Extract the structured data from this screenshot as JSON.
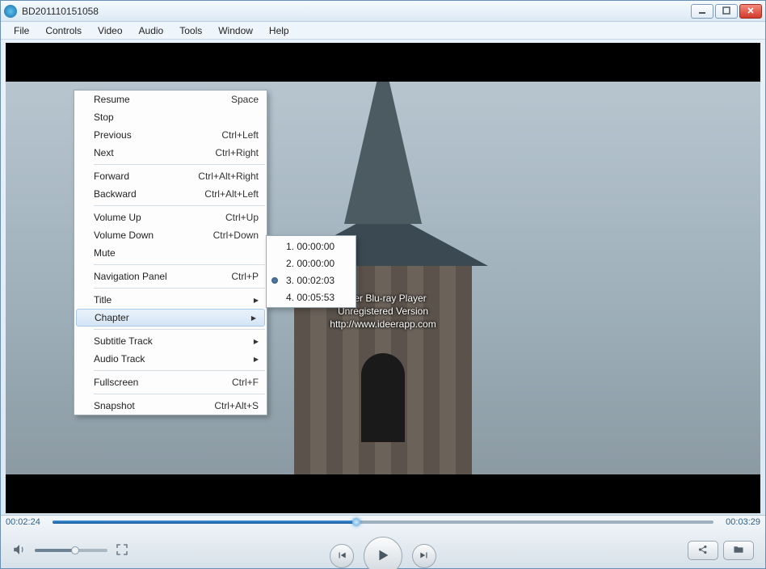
{
  "titlebar": {
    "title": "BD201110151058"
  },
  "menubar": [
    "File",
    "Controls",
    "Video",
    "Audio",
    "Tools",
    "Window",
    "Help"
  ],
  "watermark": {
    "line1": "iDeer Blu-ray Player",
    "line2": "Unregistered Version",
    "line3": "http://www.ideerapp.com"
  },
  "context_menu": {
    "groups": [
      [
        {
          "label": "Resume",
          "shortcut": "Space"
        },
        {
          "label": "Stop",
          "shortcut": ""
        },
        {
          "label": "Previous",
          "shortcut": "Ctrl+Left"
        },
        {
          "label": "Next",
          "shortcut": "Ctrl+Right"
        }
      ],
      [
        {
          "label": "Forward",
          "shortcut": "Ctrl+Alt+Right"
        },
        {
          "label": "Backward",
          "shortcut": "Ctrl+Alt+Left"
        }
      ],
      [
        {
          "label": "Volume Up",
          "shortcut": "Ctrl+Up"
        },
        {
          "label": "Volume Down",
          "shortcut": "Ctrl+Down"
        },
        {
          "label": "Mute",
          "shortcut": ""
        }
      ],
      [
        {
          "label": "Navigation Panel",
          "shortcut": "Ctrl+P"
        }
      ],
      [
        {
          "label": "Title",
          "submenu": true
        },
        {
          "label": "Chapter",
          "submenu": true,
          "selected": true
        }
      ],
      [
        {
          "label": "Subtitle Track",
          "submenu": true
        },
        {
          "label": "Audio Track",
          "submenu": true
        }
      ],
      [
        {
          "label": "Fullscreen",
          "shortcut": "Ctrl+F"
        }
      ],
      [
        {
          "label": "Snapshot",
          "shortcut": "Ctrl+Alt+S"
        }
      ]
    ]
  },
  "chapter_submenu": {
    "items": [
      {
        "label": "1. 00:00:00",
        "checked": false
      },
      {
        "label": "2. 00:00:00",
        "checked": false
      },
      {
        "label": "3. 00:02:03",
        "checked": true
      },
      {
        "label": "4. 00:05:53",
        "checked": false
      }
    ]
  },
  "seek": {
    "current": "00:02:24",
    "total": "00:03:29"
  },
  "icons": {
    "minimize": "minimize-icon",
    "maximize": "maximize-icon",
    "close": "close-icon",
    "volume": "volume-icon",
    "fullscreen": "fullscreen-icon",
    "prev": "previous-icon",
    "play": "play-icon",
    "next": "next-icon",
    "share": "share-icon",
    "open": "folder-icon"
  }
}
